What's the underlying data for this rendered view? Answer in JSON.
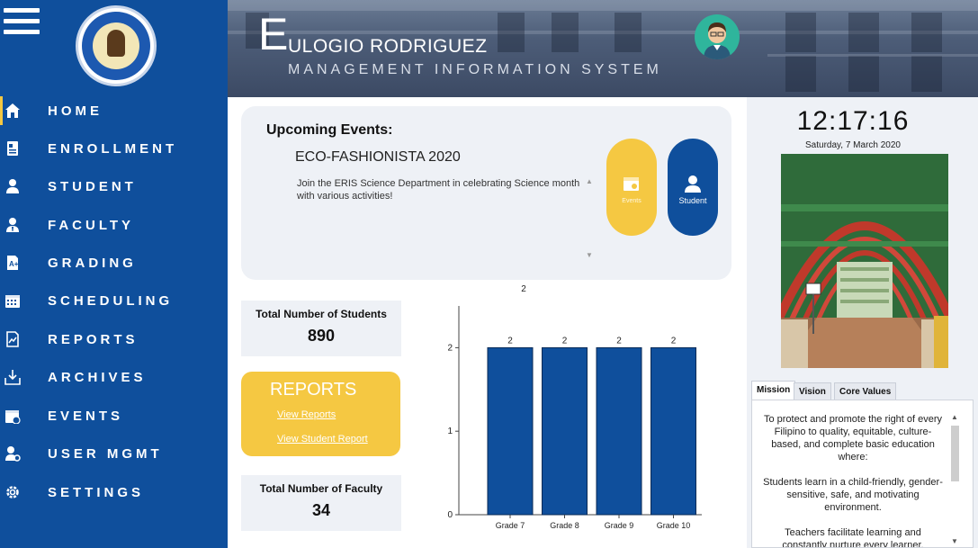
{
  "colors": {
    "sidebar": "#0f4f9c",
    "accent_yellow": "#f5c842",
    "panel": "#eef1f6",
    "bar": "#0f4f9c"
  },
  "sidebar": {
    "items": [
      {
        "label": "HOME",
        "icon": "home-icon",
        "active": true
      },
      {
        "label": "ENROLLMENT",
        "icon": "enrollment-icon"
      },
      {
        "label": "STUDENT",
        "icon": "student-icon"
      },
      {
        "label": "FACULTY",
        "icon": "faculty-icon"
      },
      {
        "label": "GRADING",
        "icon": "grading-icon"
      },
      {
        "label": "SCHEDULING",
        "icon": "calendar-icon"
      },
      {
        "label": "REPORTS",
        "icon": "reports-icon"
      },
      {
        "label": "ARCHIVES",
        "icon": "archive-icon"
      },
      {
        "label": "EVENTS",
        "icon": "events-icon"
      },
      {
        "label": "USER MGMT",
        "icon": "user-mgmt-icon"
      },
      {
        "label": "SETTINGS",
        "icon": "gear-icon"
      }
    ]
  },
  "header": {
    "title_initial": "E",
    "title_rest": "ULOGIO RODRIGUEZ",
    "subtitle": "MANAGEMENT INFORMATION SYSTEM"
  },
  "events": {
    "heading": "Upcoming Events:",
    "title": "ECO-FASHIONISTA 2020",
    "description": "Join the ERIS Science Department in celebrating Science month with various activities!",
    "events_button": "Events",
    "student_button": "Student"
  },
  "stats": {
    "students_label": "Total Number of Students",
    "students_value": "890",
    "faculty_label": "Total Number of Faculty",
    "faculty_value": "34"
  },
  "reports": {
    "title": "REPORTS",
    "link1": "View Reports",
    "link2": "View Student Report"
  },
  "chart_data": {
    "type": "bar",
    "title": "2",
    "categories": [
      "Grade 7",
      "Grade 8",
      "Grade 9",
      "Grade 10"
    ],
    "values": [
      2,
      2,
      2,
      2
    ],
    "ylim": [
      0,
      2.5
    ],
    "yticks": [
      0,
      1,
      2
    ],
    "color": "#0f4f9c"
  },
  "right_panel": {
    "time": "12:17:16",
    "date": "Saturday, 7 March 2020",
    "tabs": [
      "Mission",
      "Vision",
      "Core Values"
    ],
    "mission_paragraphs": [
      "To protect and promote the right of every Filipino to quality, equitable, culture-based, and complete basic education where:",
      "Students learn in a child-friendly, gender-sensitive, safe, and motivating environment.",
      "Teachers facilitate learning and constantly nurture every learner."
    ]
  }
}
